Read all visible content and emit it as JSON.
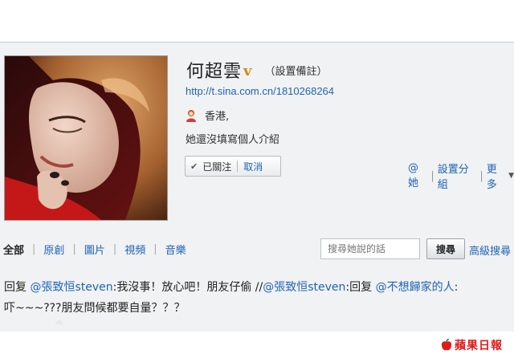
{
  "profile": {
    "name": "何超雲",
    "verified_mark": "v",
    "remark_link": "（設置備註）",
    "url": "http://t.sina.com.cn/1810268264",
    "location": "香港,",
    "intro": "她還沒填寫個人介紹"
  },
  "follow": {
    "followed_label": "已關注",
    "cancel_label": "取消"
  },
  "side_links": {
    "at_her": "@她",
    "set_group": "設置分組",
    "more": "更多"
  },
  "tabs": [
    "全部",
    "原創",
    "圖片",
    "視頻",
    "音樂"
  ],
  "search": {
    "placeholder": "搜尋她說的話",
    "button": "搜尋",
    "advanced": "高級搜尋"
  },
  "post": {
    "t1": "回复 ",
    "m1": "@張致恒steven",
    "t2": ":我沒事！放心吧！朋友仔偷 //",
    "m2": "@張致恒steven",
    "t3": ":回复 ",
    "m3": "@不想歸家的人",
    "t4": ":",
    "line2": "吓~~~???朋友問候都要自量？？？"
  },
  "watermark": "蘋果日報",
  "colors": {
    "link": "#1f63b5",
    "panel": "#f0f2f3",
    "verified": "#d28a1a",
    "watermark": "#e01a1a"
  }
}
